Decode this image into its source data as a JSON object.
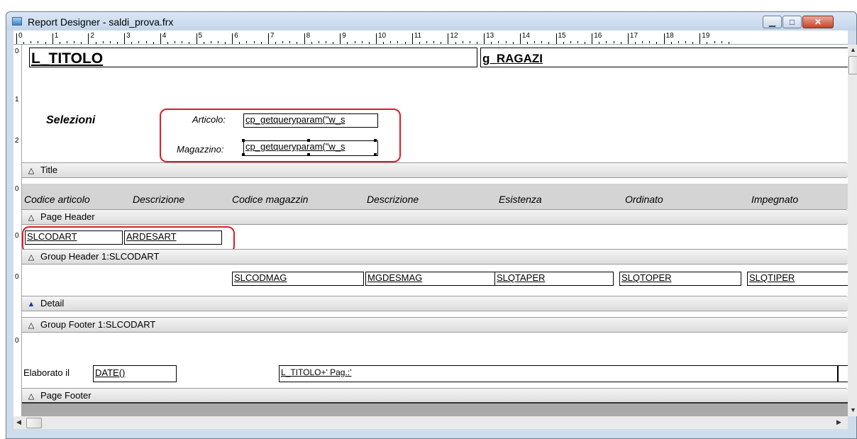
{
  "window": {
    "title": "Report Designer - saldi_prova.frx"
  },
  "ruler": {
    "top_numbers": [
      "0",
      "1",
      "2",
      "3",
      "4",
      "5",
      "6",
      "7",
      "8",
      "9",
      "10",
      "11",
      "12",
      "13",
      "14",
      "15",
      "16",
      "17",
      "18",
      "19"
    ]
  },
  "title_band": {
    "titolo": "L_TITOLO",
    "ragazi": "g_RAGAZI",
    "selezioni": "Selezioni",
    "articolo_label": "Articolo:",
    "articolo_value": "cp_getqueryparam(\"w_s",
    "magazzino_label": "Magazzino:",
    "magazzino_value": "cp_getqueryparam(\"w_s"
  },
  "bands": {
    "title": "Title",
    "page_header": "Page Header",
    "group_header": "Group Header 1:SLCODART",
    "detail": "Detail",
    "group_footer": "Group Footer 1:SLCODART",
    "page_footer": "Page Footer"
  },
  "page_header": {
    "columns": [
      "Codice articolo",
      "Descrizione",
      "Codice magazzin",
      "Descrizione",
      "Esistenza",
      "Ordinato",
      "Impegnato"
    ]
  },
  "group_header": {
    "fields": [
      "SLCODART",
      "ARDESART"
    ]
  },
  "detail": {
    "fields": [
      "SLCODMAG",
      "MGDESMAG",
      "SLQTAPER",
      "SLQTOPER",
      "SLQTIPER"
    ]
  },
  "page_footer": {
    "elaborato_label": "Elaborato il",
    "date_field": "DATE()",
    "titolo_pag": "L_TITOLO+' Pag.:'"
  },
  "icons": {
    "band_collapsed": "triangle-outline-icon",
    "band_selected": "triangle-filled-icon"
  },
  "colors": {
    "highlight": "#d81f26",
    "band": "#dcdcdc"
  }
}
